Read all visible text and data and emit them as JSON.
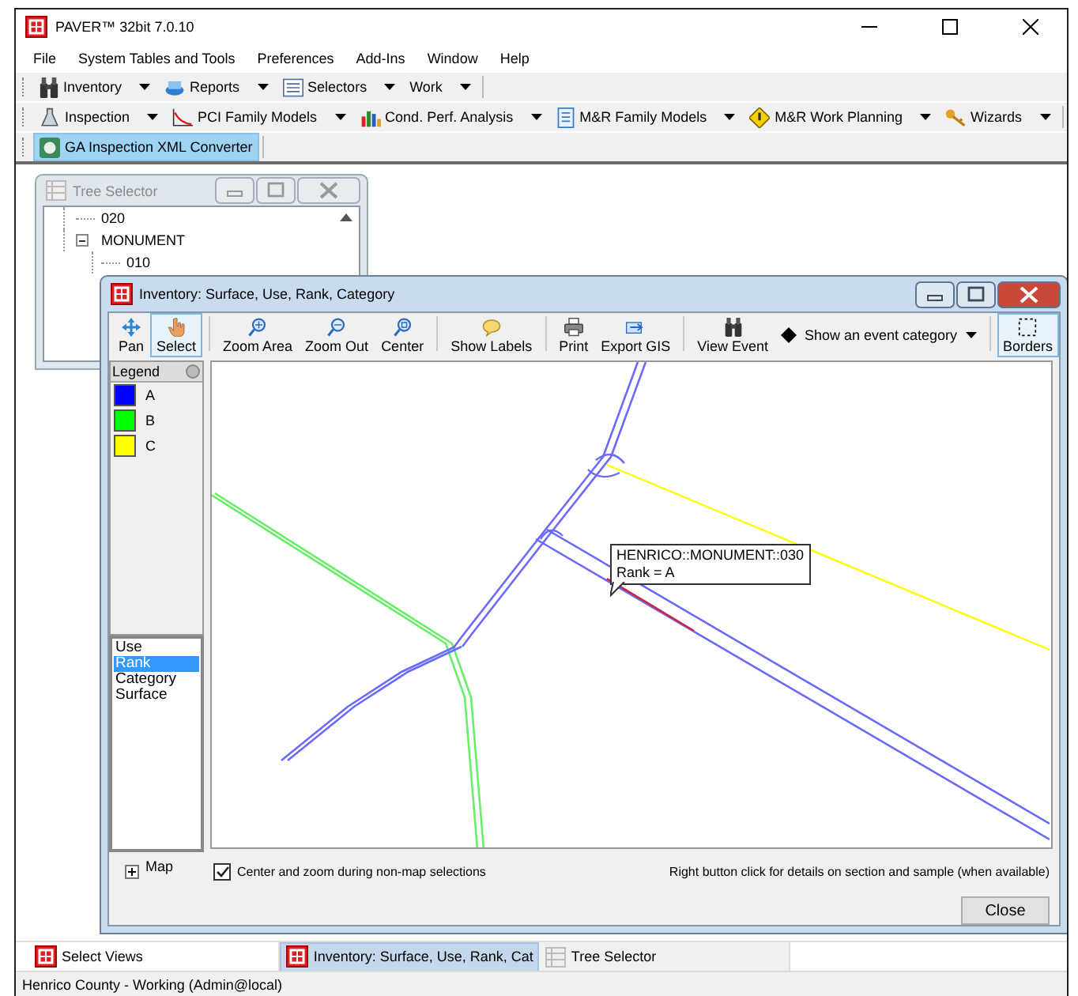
{
  "window": {
    "title": "PAVER™ 32bit 7.0.10"
  },
  "menu": [
    "File",
    "System Tables and Tools",
    "Preferences",
    "Add-Ins",
    "Window",
    "Help"
  ],
  "toolbars": [
    [
      {
        "label": "Inventory",
        "dropdown": true,
        "selected": false
      },
      {
        "label": "Reports",
        "dropdown": true,
        "selected": false
      },
      {
        "label": "Selectors",
        "dropdown": true,
        "selected": false
      },
      {
        "label": "Work",
        "dropdown": true,
        "selected": false
      }
    ],
    [
      {
        "label": "Inspection",
        "dropdown": true,
        "selected": false
      },
      {
        "label": "PCI Family Models",
        "dropdown": true,
        "selected": false
      },
      {
        "label": "Cond. Perf. Analysis",
        "dropdown": true,
        "selected": false
      },
      {
        "label": "M&R Family Models",
        "dropdown": true,
        "selected": false
      },
      {
        "label": "M&R Work Planning",
        "dropdown": true,
        "selected": false
      },
      {
        "label": "Wizards",
        "dropdown": true,
        "selected": false
      }
    ],
    [
      {
        "label": "GA Inspection XML Converter",
        "dropdown": false,
        "selected": true
      }
    ]
  ],
  "tree_selector": {
    "title": "Tree Selector",
    "items": [
      {
        "label": "020",
        "selected": false
      },
      {
        "label": "MONUMENT",
        "expanded": true,
        "selected": false,
        "children": [
          {
            "label": "010",
            "selected": false
          }
        ]
      }
    ]
  },
  "inventory_window": {
    "title": "Inventory: Surface, Use, Rank, Category",
    "toolbar": [
      [
        {
          "label": "Pan",
          "selected": false
        },
        {
          "label": "Select",
          "selected": true
        }
      ],
      [
        {
          "label": "Zoom Area",
          "selected": false
        },
        {
          "label": "Zoom Out",
          "selected": false
        },
        {
          "label": "Center",
          "selected": false
        }
      ],
      [
        {
          "label": "Show Labels",
          "selected": false
        }
      ],
      [
        {
          "label": "Print",
          "selected": false
        },
        {
          "label": "Export GIS",
          "selected": false
        }
      ],
      [
        {
          "label": "View Event",
          "selected": false
        },
        {
          "label": "Show an event category",
          "selected": false,
          "dropdown": true
        }
      ],
      [
        {
          "label": "Borders",
          "selected": true
        }
      ]
    ],
    "legend": {
      "title": "Legend",
      "items": [
        {
          "label": "A",
          "color": "#0000ff"
        },
        {
          "label": "B",
          "color": "#00ff00"
        },
        {
          "label": "C",
          "color": "#ffff00"
        }
      ]
    },
    "layers_list": [
      {
        "label": "Use",
        "selected": false
      },
      {
        "label": "Rank",
        "selected": true
      },
      {
        "label": "Category",
        "selected": false
      },
      {
        "label": "Surface",
        "selected": false
      }
    ],
    "map_layers": {
      "label": "Map",
      "expanded": false
    },
    "map_tooltip": [
      "HENRICO::MONUMENT::030",
      "Rank = A"
    ],
    "center_zoom": {
      "label": "Center and zoom during non-map selections",
      "checked": true
    },
    "hint": "Right button click for details on section and sample (when available)",
    "close_button": "Close"
  },
  "taskbar": [
    {
      "label": "Select Views",
      "selected": false
    },
    {
      "label": "Inventory: Surface, Use, Rank, Cat",
      "selected": true
    },
    {
      "label": "Tree Selector",
      "selected": false
    }
  ],
  "status_bar": "Henrico County - Working (Admin@local)"
}
